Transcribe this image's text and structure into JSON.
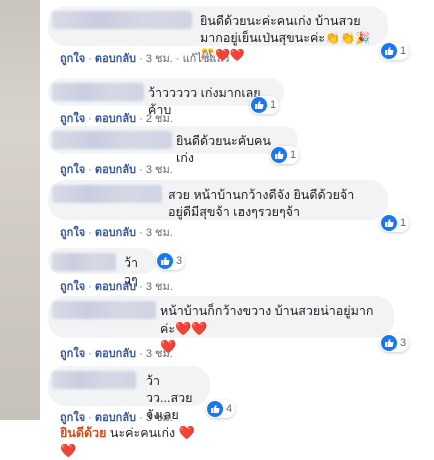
{
  "comments": [
    {
      "text_main": "ยินดีด้วยนะค่ะคนเก่ง บ้านสวยมากอยู่เย็นเป่นสุขนะค่ะ",
      "emoji": "👏👏🎉🎊❤️❤️",
      "reaction_count": "1",
      "like": "ถูกใจ",
      "reply": "ตอบกลับ",
      "time": "3 ชม.",
      "edited": "แก้ไขแล้ว"
    },
    {
      "text_main": "ว้าววววว เก่งมากเลยค้าบ",
      "reaction_count": "1",
      "like": "ถูกใจ",
      "reply": "ตอบกลับ",
      "time": "2 ชม."
    },
    {
      "text_main": "ยินดีด้วยนะคับคนเก่ง",
      "reaction_count": "1",
      "like": "ถูกใจ",
      "reply": "ตอบกลับ",
      "time": "3 ชม."
    },
    {
      "text_main": "สวย หน้าบ้านกว้างดีจัง ยินดีด้วยจ้า อยู่ดีมีสุขจ้า เฮงๆรวยๆจ้า",
      "reaction_count": "1",
      "like": "ถูกใจ",
      "reply": "ตอบกลับ",
      "time": "3 ชม."
    },
    {
      "text_main": "ว้าวๆ",
      "reaction_count": "3",
      "like": "ถูกใจ",
      "reply": "ตอบกลับ",
      "time": "3 ชม."
    },
    {
      "text_main": "หน้าบ้านก็กว้างขวาง บ้านสวยน่าอยู่มากค่ะ",
      "hearts": "❤️❤️",
      "heart_line2": "❤️",
      "reaction_count": "3",
      "like": "ถูกใจ",
      "reply": "ตอบกลับ",
      "time": "3 ชม."
    },
    {
      "text_main": "ว้าวว...สวยจังเลย",
      "highlight": "ยินดีด้วย",
      "text_tail": " นะค่ะคนเก่ง ",
      "hearts": "❤️❤️",
      "reaction_count": "4",
      "like": "ถูกใจ",
      "reply": "ตอบกลับ",
      "time": "3 ชม."
    }
  ],
  "colors": {
    "like_blue": "#1877f2",
    "action_blue": "#385898",
    "bubble": "#f2f3f5"
  },
  "icons": {
    "reaction": "like-thumb-icon"
  }
}
